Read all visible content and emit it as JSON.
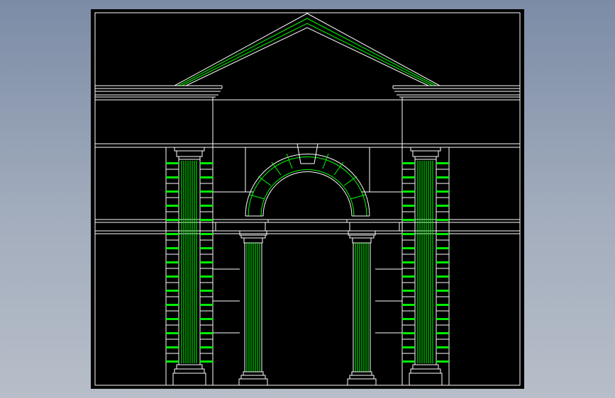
{
  "drawing": {
    "background": "#000000",
    "line_color": "#ffffff",
    "accent_color": "#00ff00",
    "elements": [
      "pediment",
      "cornice",
      "frieze",
      "arch",
      "keystone",
      "voussoirs",
      "pilaster-left",
      "pilaster-right",
      "column-left",
      "column-right",
      "rusticated-blocks"
    ]
  }
}
